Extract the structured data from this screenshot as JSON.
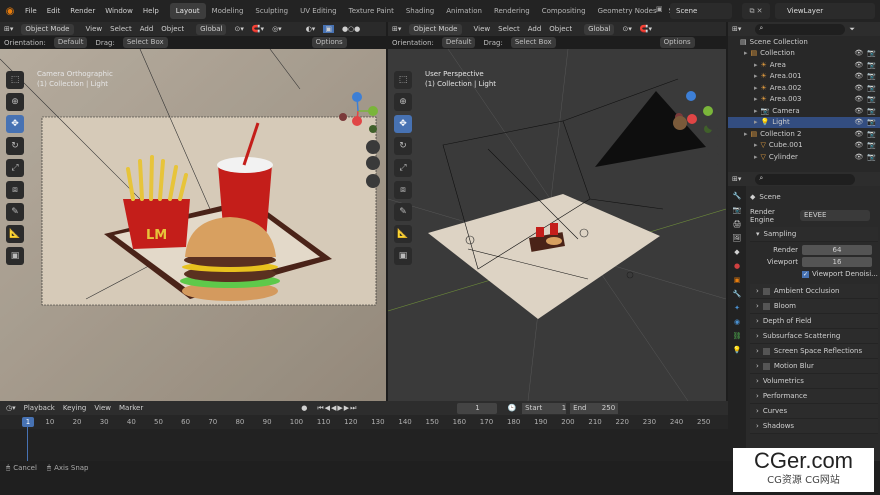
{
  "topbar": {
    "menus": [
      "File",
      "Edit",
      "Render",
      "Window",
      "Help"
    ],
    "tabs": [
      "Layout",
      "Modeling",
      "Sculpting",
      "UV Editing",
      "Texture Paint",
      "Shading",
      "Animation",
      "Rendering",
      "Compositing",
      "Geometry Nodes",
      "Scripting"
    ],
    "active_tab": "Layout",
    "add_tab": "+",
    "scene": "Scene",
    "view_layer": "ViewLayer"
  },
  "left_viewport": {
    "mode": "Object Mode",
    "menus": [
      "View",
      "Select",
      "Add",
      "Object"
    ],
    "transform": "Global",
    "orientation_label": "Orientation:",
    "orientation": "Default",
    "drag_label": "Drag:",
    "drag": "Select Box",
    "options": "Options",
    "view_name": "Camera Orthographic",
    "context": "(1) Collection | Light",
    "fries_logo": "LM"
  },
  "right_viewport": {
    "mode": "Object Mode",
    "menus": [
      "View",
      "Select",
      "Add",
      "Object"
    ],
    "transform": "Global",
    "orientation_label": "Orientation:",
    "orientation": "Default",
    "drag_label": "Drag:",
    "drag": "Select Box",
    "options": "Options",
    "view_name": "User Perspective",
    "context": "(1) Collection | Light"
  },
  "outliner": {
    "root": "Scene Collection",
    "items": [
      {
        "label": "Collection",
        "level": 1,
        "selected": false
      },
      {
        "label": "Area",
        "level": 2,
        "selected": false
      },
      {
        "label": "Area.001",
        "level": 2,
        "selected": false
      },
      {
        "label": "Area.002",
        "level": 2,
        "selected": false
      },
      {
        "label": "Area.003",
        "level": 2,
        "selected": false
      },
      {
        "label": "Camera",
        "level": 2,
        "selected": false
      },
      {
        "label": "Light",
        "level": 2,
        "selected": true
      },
      {
        "label": "Collection 2",
        "level": 1,
        "selected": false
      },
      {
        "label": "Cube.001",
        "level": 2,
        "selected": false
      },
      {
        "label": "Cylinder",
        "level": 2,
        "selected": false
      }
    ]
  },
  "properties": {
    "scene_name": "Scene",
    "render_engine_label": "Render Engine",
    "render_engine": "EEVEE",
    "sampling": "Sampling",
    "render_label": "Render",
    "render_samples": "64",
    "viewport_label": "Viewport",
    "viewport_samples": "16",
    "denoise": "Viewport Denoisi...",
    "panels": [
      "Ambient Occlusion",
      "Bloom",
      "Depth of Field",
      "Subsurface Scattering",
      "Screen Space Reflections",
      "Motion Blur",
      "Volumetrics",
      "Performance",
      "Curves",
      "Shadows"
    ]
  },
  "timeline": {
    "menus": [
      "Playback",
      "Keying",
      "View",
      "Marker"
    ],
    "current_frame": "1",
    "start_label": "Start",
    "start": "1",
    "end_label": "End",
    "end": "250",
    "ticks": [
      "1",
      "10",
      "20",
      "30",
      "40",
      "50",
      "60",
      "70",
      "80",
      "90",
      "100",
      "110",
      "120",
      "130",
      "140",
      "150",
      "160",
      "170",
      "180",
      "190",
      "200",
      "210",
      "220",
      "230",
      "240",
      "250"
    ]
  },
  "statusbar": {
    "cancel": "Cancel",
    "axis_snap": "Axis Snap"
  },
  "watermark": {
    "title": "CGer.com",
    "subtitle": "CG资源 CG网站"
  },
  "colors": {
    "accent": "#4772b3",
    "orange": "#e87d0d",
    "selected_row": "#334d80"
  }
}
